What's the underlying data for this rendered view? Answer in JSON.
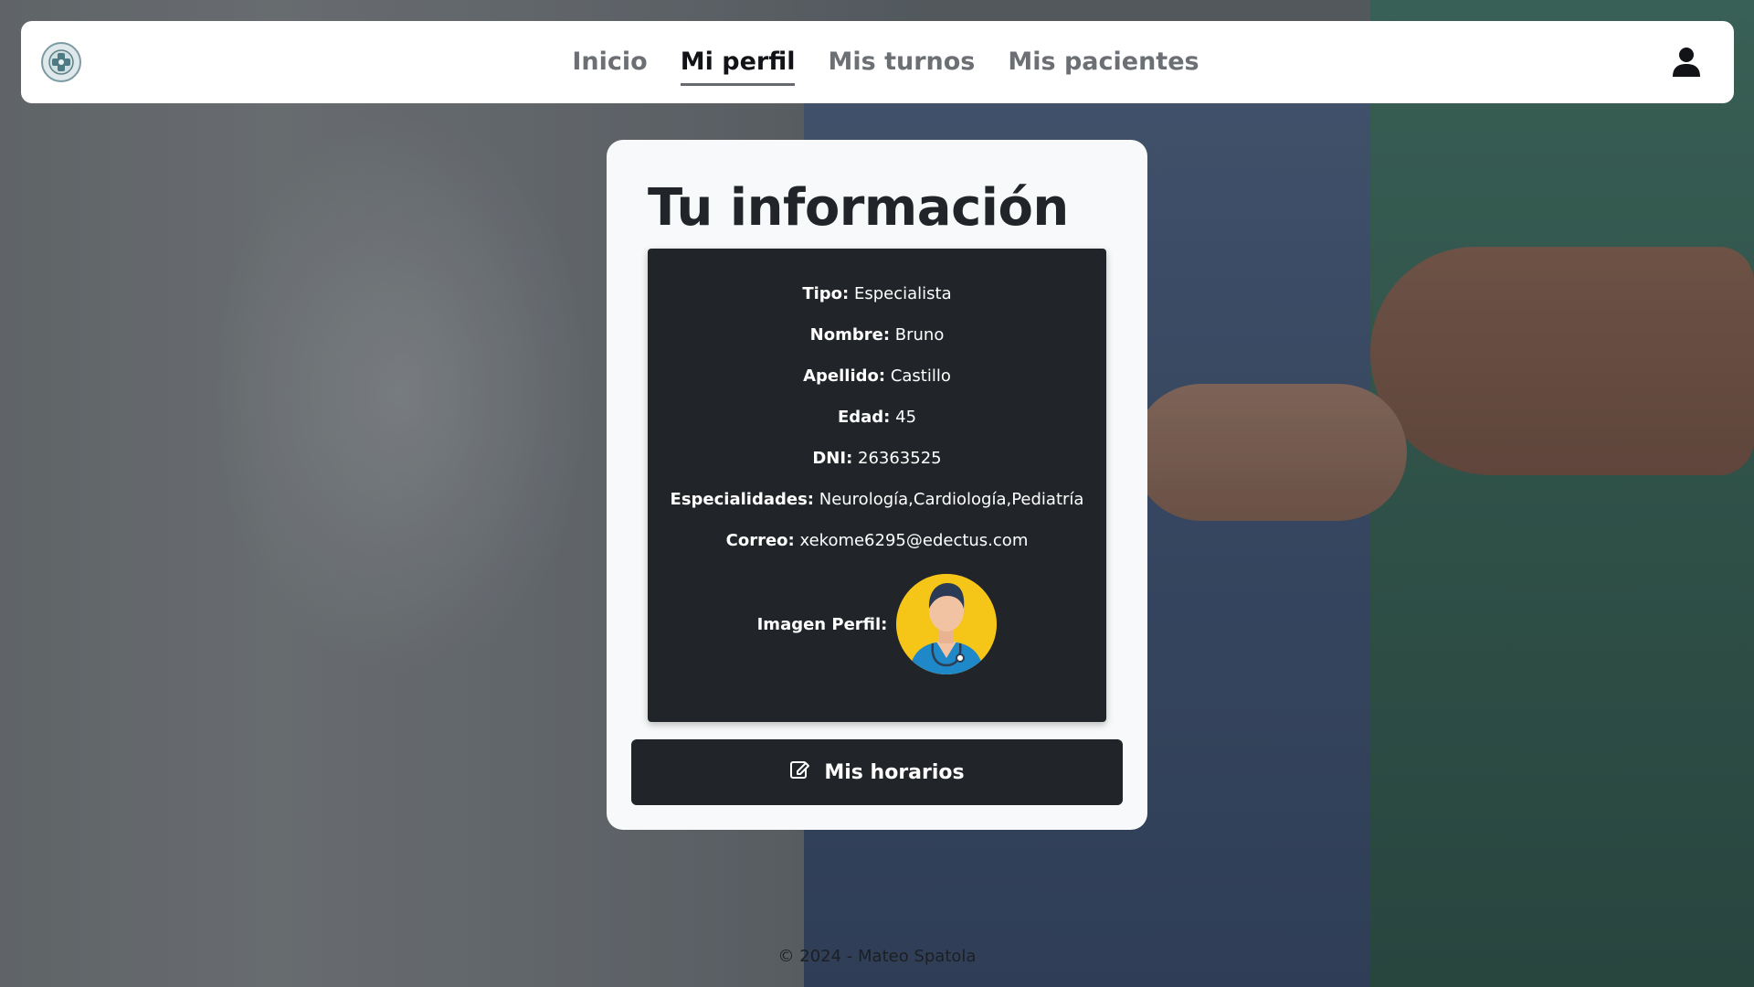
{
  "nav": {
    "links": [
      "Inicio",
      "Mi perfil",
      "Mis turnos",
      "Mis pacientes"
    ],
    "active": "Mi perfil"
  },
  "icons": {
    "logo": "medical-cross-logo",
    "user": "user-icon",
    "button": "edit-icon",
    "avatar": "doctor-avatar"
  },
  "card": {
    "title": "Tu información",
    "fields": [
      {
        "label": "Tipo:",
        "value": "Especialista"
      },
      {
        "label": "Nombre:",
        "value": "Bruno"
      },
      {
        "label": "Apellido:",
        "value": "Castillo"
      },
      {
        "label": "Edad:",
        "value": "45"
      },
      {
        "label": "DNI:",
        "value": "26363525"
      },
      {
        "label": "Especialidades:",
        "value": "Neurología,Cardiología,Pediatría"
      },
      {
        "label": "Correo:",
        "value": "xekome6295@edectus.com"
      }
    ],
    "image_label": "Imagen Perfil:",
    "button_label": "Mis horarios"
  },
  "footer": "© 2024 - Mateo Spatola",
  "colors": {
    "dark": "#212529",
    "card_bg": "#f8f9fa",
    "avatar_bg": "#f5c518"
  }
}
